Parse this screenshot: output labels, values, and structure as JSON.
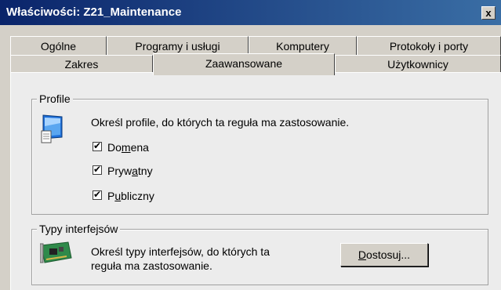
{
  "window": {
    "title": "Właściwości: Z21_Maintenance",
    "close_label": "x"
  },
  "tabs_row1": [
    {
      "label": "Ogólne"
    },
    {
      "label": "Programy i usługi"
    },
    {
      "label": "Komputery"
    },
    {
      "label": "Protokoły i porty"
    }
  ],
  "tabs_row2": [
    {
      "label": "Zakres"
    },
    {
      "label": "Zaawansowane",
      "active": true
    },
    {
      "label": "Użytkownicy"
    }
  ],
  "profile_group": {
    "title": "Profile",
    "description": "Określ profile, do których ta reguła ma zastosowanie.",
    "icon": "computer-profile-icon",
    "options": [
      {
        "label": "Domena",
        "pre": "Do",
        "mnemonic": "m",
        "post": "ena",
        "checked": true
      },
      {
        "label": "Prywatny",
        "pre": "Pryw",
        "mnemonic": "a",
        "post": "tny",
        "checked": true
      },
      {
        "label": "Publiczny",
        "pre": "P",
        "mnemonic": "u",
        "post": "bliczny",
        "checked": true
      }
    ]
  },
  "interfaces_group": {
    "title": "Typy interfejsów",
    "description_line1": "Określ typy interfejsów, do których ta",
    "description_line2": "reguła ma zastosowanie.",
    "icon": "network-card-icon",
    "button": {
      "label": "Dostosuj...",
      "mnemonic": "D",
      "rest": "ostosuj..."
    }
  }
}
